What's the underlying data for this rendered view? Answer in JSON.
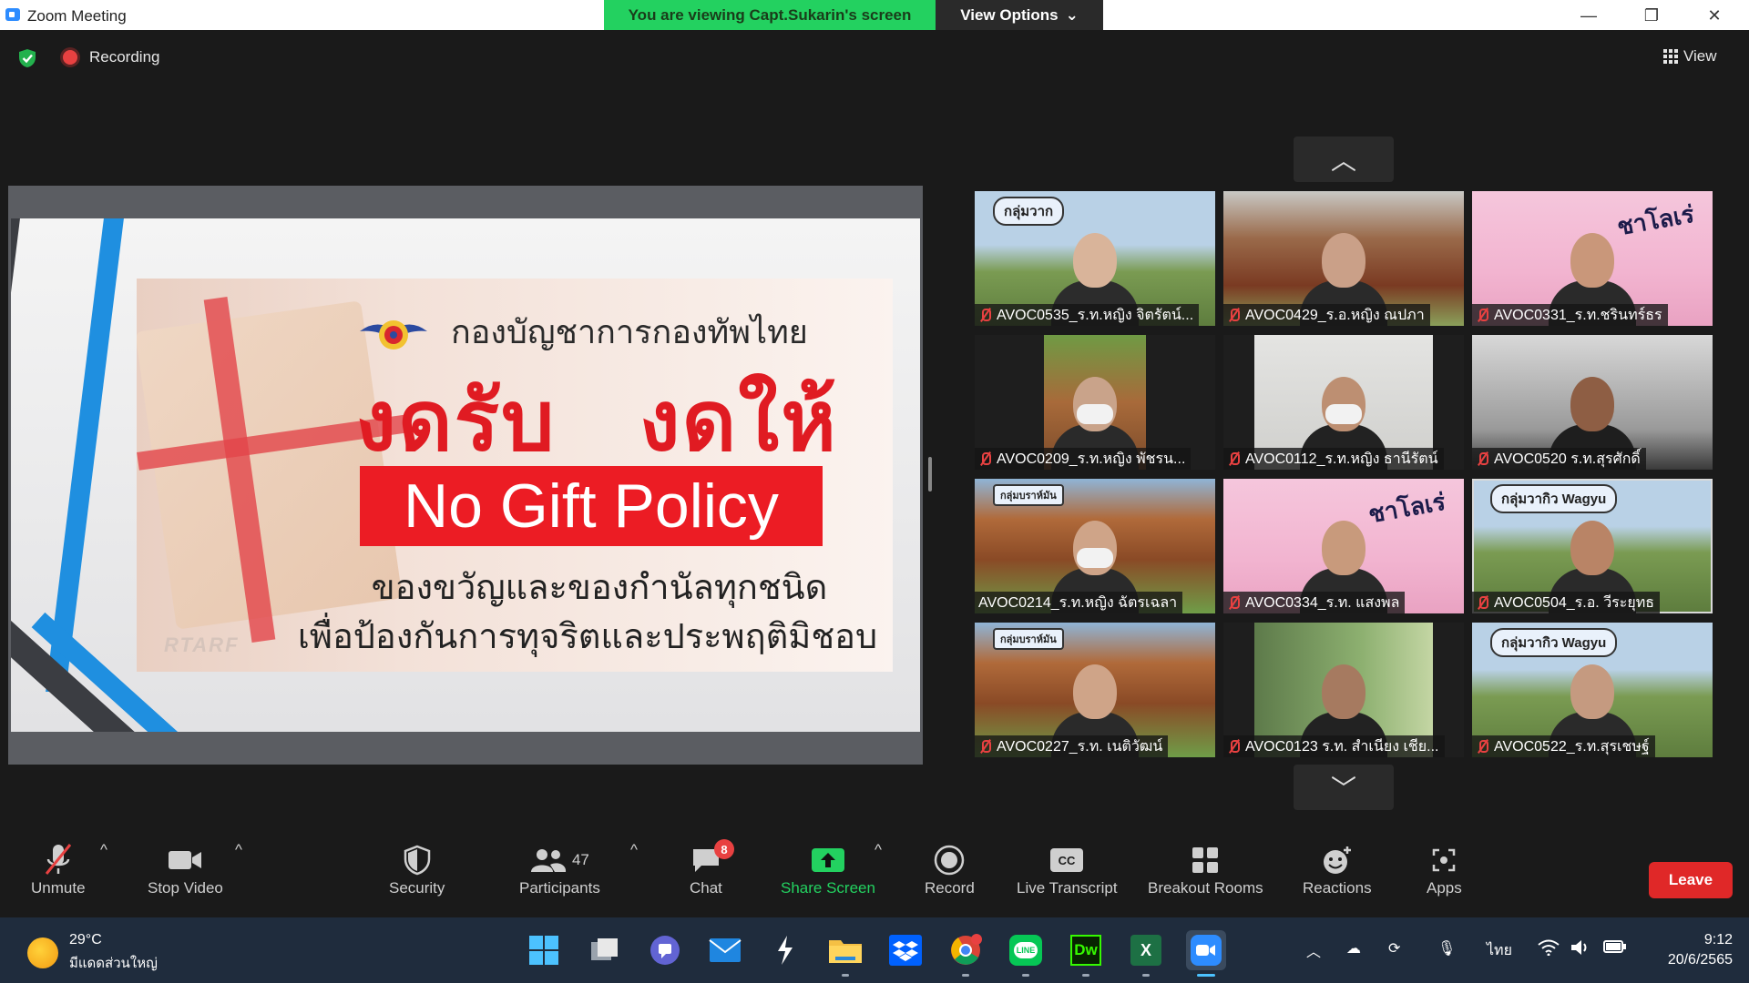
{
  "window": {
    "title": "Zoom Meeting"
  },
  "banner": {
    "viewing": "You are viewing Capt.Sukarin's screen",
    "view_options": "View Options"
  },
  "meeting": {
    "recording_label": "Recording",
    "view_label": "View"
  },
  "slide": {
    "org": "กองบัญชาการกองทัพไทย",
    "headline_a": "งดรับ",
    "headline_b": "งดให้",
    "policy": "No Gift Policy",
    "line1": "ของขวัญและของกำนัลทุกชนิด",
    "line2": "เพื่อป้องกันการทุจริตและประพฤติมิชอบ",
    "watermark": "RTARF"
  },
  "participants": [
    {
      "name": "AVOC0535_ร.ท.หญิง จิตรัตน์...",
      "sign": "กลุ่มวาก"
    },
    {
      "name": "AVOC0429_ร.อ.หญิง ณปภา",
      "sign": ""
    },
    {
      "name": "AVOC0331_ร.ท.ชรินทร์ธร",
      "sign": "ชาโลเร่"
    },
    {
      "name": "AVOC0209_ร.ท.หญิง พัชรน...",
      "sign": ""
    },
    {
      "name": "AVOC0112_ร.ท.หญิง ธานีรัตน์",
      "sign": ""
    },
    {
      "name": "AVOC0520 ร.ท.สุรศักดิ์",
      "sign": ""
    },
    {
      "name": "AVOC0214_ร.ท.หญิง ฉัตรเฉลา",
      "sign": "กลุ่มบราห์มัน"
    },
    {
      "name": "AVOC0334_ร.ท. แสงพล",
      "sign": "ชาโลเร่"
    },
    {
      "name": "AVOC0504_ร.อ. วีระยุทธ",
      "sign": "กลุ่มวากิว Wagyu"
    },
    {
      "name": "AVOC0227_ร.ท. เนติวัฒน์",
      "sign": "กลุ่มบราห์มัน"
    },
    {
      "name": "AVOC0123 ร.ท. สำเนียง เชีย...",
      "sign": ""
    },
    {
      "name": "AVOC0522_ร.ท.สุรเชษฐ์",
      "sign": "กลุ่มวากิว Wagyu"
    }
  ],
  "toolbar": {
    "unmute": "Unmute",
    "stop_video": "Stop Video",
    "security": "Security",
    "participants": "Participants",
    "participants_count": "47",
    "chat": "Chat",
    "chat_badge": "8",
    "share_screen": "Share Screen",
    "record": "Record",
    "live_transcript": "Live Transcript",
    "breakout_rooms": "Breakout Rooms",
    "reactions": "Reactions",
    "apps": "Apps",
    "leave": "Leave"
  },
  "taskbar": {
    "weather_temp": "29°C",
    "weather_desc": "มีแดดส่วนใหญ่",
    "language": "ไทย",
    "time": "9:12",
    "date": "20/6/2565",
    "dreamweaver": "Dw",
    "excel": "X",
    "line": "LINE"
  },
  "colors": {
    "accent_green": "#23d160",
    "leave_red": "#e02828",
    "zoom_blue": "#2d8cff",
    "mute_red": "#e84141"
  }
}
